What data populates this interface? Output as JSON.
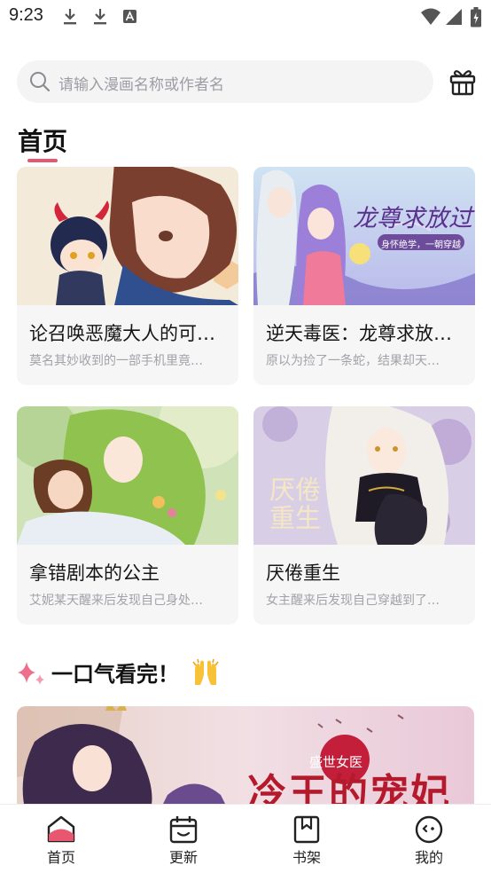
{
  "status_bar": {
    "time": "9:23",
    "notification_icons": [
      "download-icon",
      "download-icon",
      "font-app-icon"
    ],
    "system_icons": [
      "wifi-icon",
      "cellular-signal-icon",
      "battery-icon"
    ]
  },
  "search": {
    "placeholder": "请输入漫画名称或作者名",
    "icon": "search-icon",
    "side_button_icon": "gift-box-icon"
  },
  "page": {
    "title": "首页",
    "accent_color": "#e8566f"
  },
  "cards": [
    {
      "title": "论召唤恶魔大人的可…",
      "desc": "莫名其妙收到的一部手机里竟…"
    },
    {
      "title": "逆天毒医：龙尊求放…",
      "desc": "原以为捡了一条蛇，结果却天…"
    },
    {
      "title": "拿错剧本的公主",
      "desc": "艾妮某天醒来后发现自己身处…"
    },
    {
      "title": "厌倦重生",
      "desc": "女主醒来后发现自己穿越到了…"
    }
  ],
  "cover_text": {
    "card2_title": "龙尊求放过",
    "card2_tagline": "身怀绝学，一朝穿越",
    "card4_title_line1": "厌倦",
    "card4_title_line2": "重生"
  },
  "section": {
    "title": "一口气看完！",
    "leading_icon": "sparkle-icon",
    "trailing_icon": "raised-hands-emoji"
  },
  "banner": {
    "subtitle": "盛世女医",
    "title": "冷王的宠妃"
  },
  "bottom_nav": {
    "items": [
      {
        "label": "首页",
        "icon": "home-icon",
        "active": true
      },
      {
        "label": "更新",
        "icon": "calendar-icon",
        "active": false
      },
      {
        "label": "书架",
        "icon": "bookshelf-icon",
        "active": false
      },
      {
        "label": "我的",
        "icon": "profile-icon",
        "active": false
      }
    ]
  }
}
